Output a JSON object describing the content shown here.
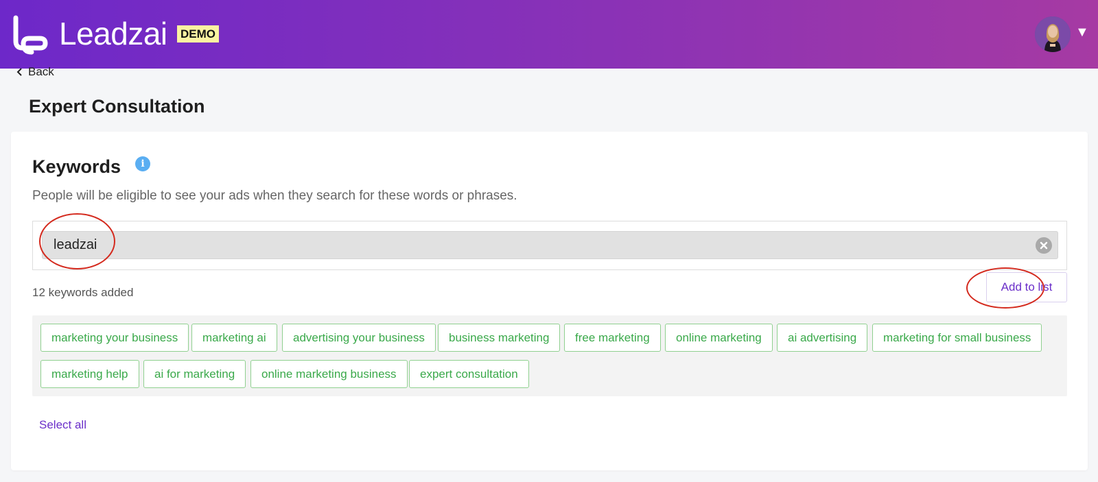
{
  "header": {
    "brand": "Leadzai",
    "badge": "DEMO",
    "avatar_icon": "user-avatar",
    "menu_caret": "▼"
  },
  "nav": {
    "back_label": "Back",
    "back_icon": "chevron-left-icon"
  },
  "page": {
    "title": "Expert Consultation"
  },
  "keywords": {
    "title": "Keywords",
    "info_glyph": "i",
    "description": "People will be eligible to see your ads when they search for these words or phrases.",
    "input_value": "leadzai",
    "input_placeholder": "",
    "count_text": "12 keywords added",
    "add_button_label": "Add to list",
    "select_all_label": "Select all",
    "chips": [
      "marketing your business",
      "marketing ai",
      "advertising your business",
      "business marketing",
      "free marketing",
      "online marketing",
      "ai advertising",
      "marketing for small business",
      "marketing help",
      "ai for marketing",
      "online marketing business",
      "expert consultation"
    ]
  },
  "colors": {
    "header_gradient_start": "#6d28c9",
    "header_gradient_end": "#a63aa3",
    "accent_purple": "#6a2ec9",
    "chip_green": "#3aa94a",
    "chip_border": "#8fd08f",
    "info_blue": "#5aaef2",
    "demo_badge_bg": "#fbf3a1",
    "annotation_red": "#d42a1e"
  }
}
